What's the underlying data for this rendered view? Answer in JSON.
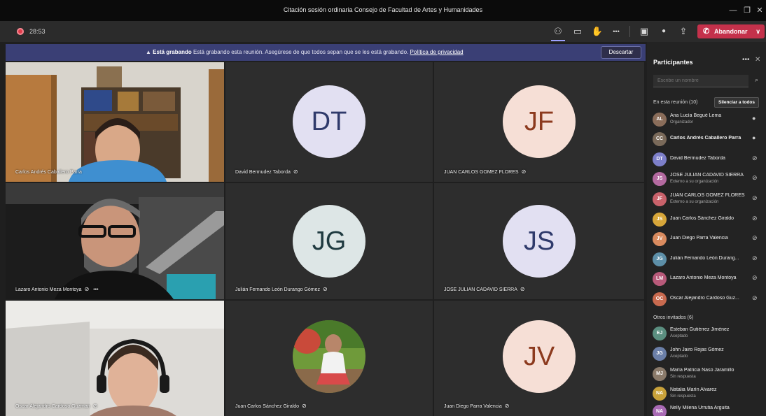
{
  "window": {
    "title": "Citación sesión ordinaria Consejo de Facultad de Artes y Humanidades",
    "minimize_glyph": "—",
    "restore_glyph": "❐",
    "close_glyph": "✕"
  },
  "toolbar": {
    "timer": "28:53",
    "leave_label": "Abandonar",
    "icons": [
      "participants-icon",
      "chat-icon",
      "raise-hand-icon",
      "more-icon",
      "camera-off-icon",
      "mic-icon",
      "share-icon"
    ],
    "glyphs": {
      "participants": "⚇",
      "chat": "▭",
      "hand": "✋",
      "more": "•••",
      "camera": "▣",
      "mic": "●",
      "share": "⇪",
      "phone": "✆",
      "chevron": "∨"
    }
  },
  "banner": {
    "title": "Está grabando",
    "message": "Está grabando esta reunión. Asegúrese de que todos sepan que se les está grabando.",
    "link": "Política de privacidad",
    "dismiss_label": "Descartar",
    "warn_glyph": "▲"
  },
  "tiles": [
    {
      "name": "Carlos Andrés Caballero Parra",
      "type": "video",
      "muted": false
    },
    {
      "name": "David Bermudez Taborda",
      "type": "avatar",
      "initials": "DT",
      "muted": true
    },
    {
      "name": "JUAN CARLOS GOMEZ FLORES",
      "type": "avatar",
      "initials": "JF",
      "muted": true
    },
    {
      "name": "Lazaro Antonio Meza Montoya",
      "type": "video",
      "muted": true,
      "extra": "•••"
    },
    {
      "name": "Julián Fernando León Durango Gómez",
      "type": "avatar",
      "initials": "JG",
      "muted": true
    },
    {
      "name": "JOSE JULIAN CADAVID SIERRA",
      "type": "avatar",
      "initials": "JS",
      "muted": true
    },
    {
      "name": "Oscar Alejandro Cardoso Guzman",
      "type": "video",
      "muted": true
    },
    {
      "name": "Juan Carlos Sánchez Giraldo",
      "type": "photo",
      "muted": true
    },
    {
      "name": "Juan Diego Parra Valencia",
      "type": "avatar",
      "initials": "JV",
      "muted": true
    }
  ],
  "panel": {
    "title": "Participantes",
    "more_glyph": "•••",
    "close_glyph": "✕",
    "search_placeholder": "Escribe un nombre",
    "search_glyph": "⌕",
    "in_meeting_label": "En esta reunión (10)",
    "mute_all_label": "Silenciar a todos",
    "mic_glyph": "●",
    "mic_off_glyph": "⊘",
    "participants": [
      {
        "name": "Ana Lucía Begué Lema",
        "sub": "Organizador",
        "initials": "AL",
        "color": "#8a6d5a",
        "mic": "on",
        "bold": false
      },
      {
        "name": "Carlos Andrés Caballero Parra",
        "sub": "",
        "initials": "CC",
        "color": "#7a6a5a",
        "mic": "on",
        "bold": true
      },
      {
        "name": "David Bermudez Taborda",
        "sub": "",
        "initials": "DT",
        "color": "#7d7fc9",
        "mic": "off",
        "bold": false
      },
      {
        "name": "JOSE JULIAN CADAVID SIERRA",
        "sub": "Externo a su organización",
        "initials": "JS",
        "color": "#b46aa0",
        "mic": "off",
        "bold": false
      },
      {
        "name": "JUAN CARLOS GOMEZ FLORES",
        "sub": "Externo a su organización",
        "initials": "JF",
        "color": "#c9626b",
        "mic": "off",
        "bold": false
      },
      {
        "name": "Juan Carlos Sánchez Giraldo",
        "sub": "",
        "initials": "JS",
        "color": "#d7a63a",
        "mic": "off",
        "bold": false
      },
      {
        "name": "Juan Diego Parra Valencia",
        "sub": "",
        "initials": "JV",
        "color": "#d98b5f",
        "mic": "off",
        "bold": false
      },
      {
        "name": "Julián Fernando León Durang...",
        "sub": "",
        "initials": "JG",
        "color": "#5d8fa8",
        "mic": "off",
        "bold": false
      },
      {
        "name": "Lazaro Antonio Meza Montoya",
        "sub": "",
        "initials": "LM",
        "color": "#b85a7a",
        "mic": "off",
        "bold": false
      },
      {
        "name": "Oscar Alejandro Cardoso Guz...",
        "sub": "",
        "initials": "OC",
        "color": "#c86a4f",
        "mic": "off",
        "bold": false
      }
    ],
    "guests_label": "Otros invitados (6)",
    "guests": [
      {
        "name": "Esteban Gutiérrez Jiménez",
        "sub": "Aceptado",
        "initials": "EJ",
        "color": "#5b8f80"
      },
      {
        "name": "John Jairo Rojas Gómez",
        "sub": "Aceptado",
        "initials": "JG",
        "color": "#6b7fa8"
      },
      {
        "name": "María Patricia Naso Jaramillo",
        "sub": "Sin respuesta",
        "initials": "MJ",
        "color": "#8a7a6a"
      },
      {
        "name": "Natalia Marín Alvarez",
        "sub": "Sin respuesta",
        "initials": "NA",
        "color": "#c9a23a"
      },
      {
        "name": "Nelly Milena Urrutia Arguita",
        "sub": "",
        "initials": "NA",
        "color": "#a86ab4"
      }
    ]
  },
  "colors": {
    "accent": "#9ea2ff",
    "leave": "#c4314b",
    "banner": "#3a3f75",
    "avatar_bg_blue": "#e2e0f2",
    "avatar_text_blue": "#2f3a6b",
    "avatar_bg_peach": "#f6dfd6",
    "avatar_text_peach": "#8c3a1e"
  }
}
